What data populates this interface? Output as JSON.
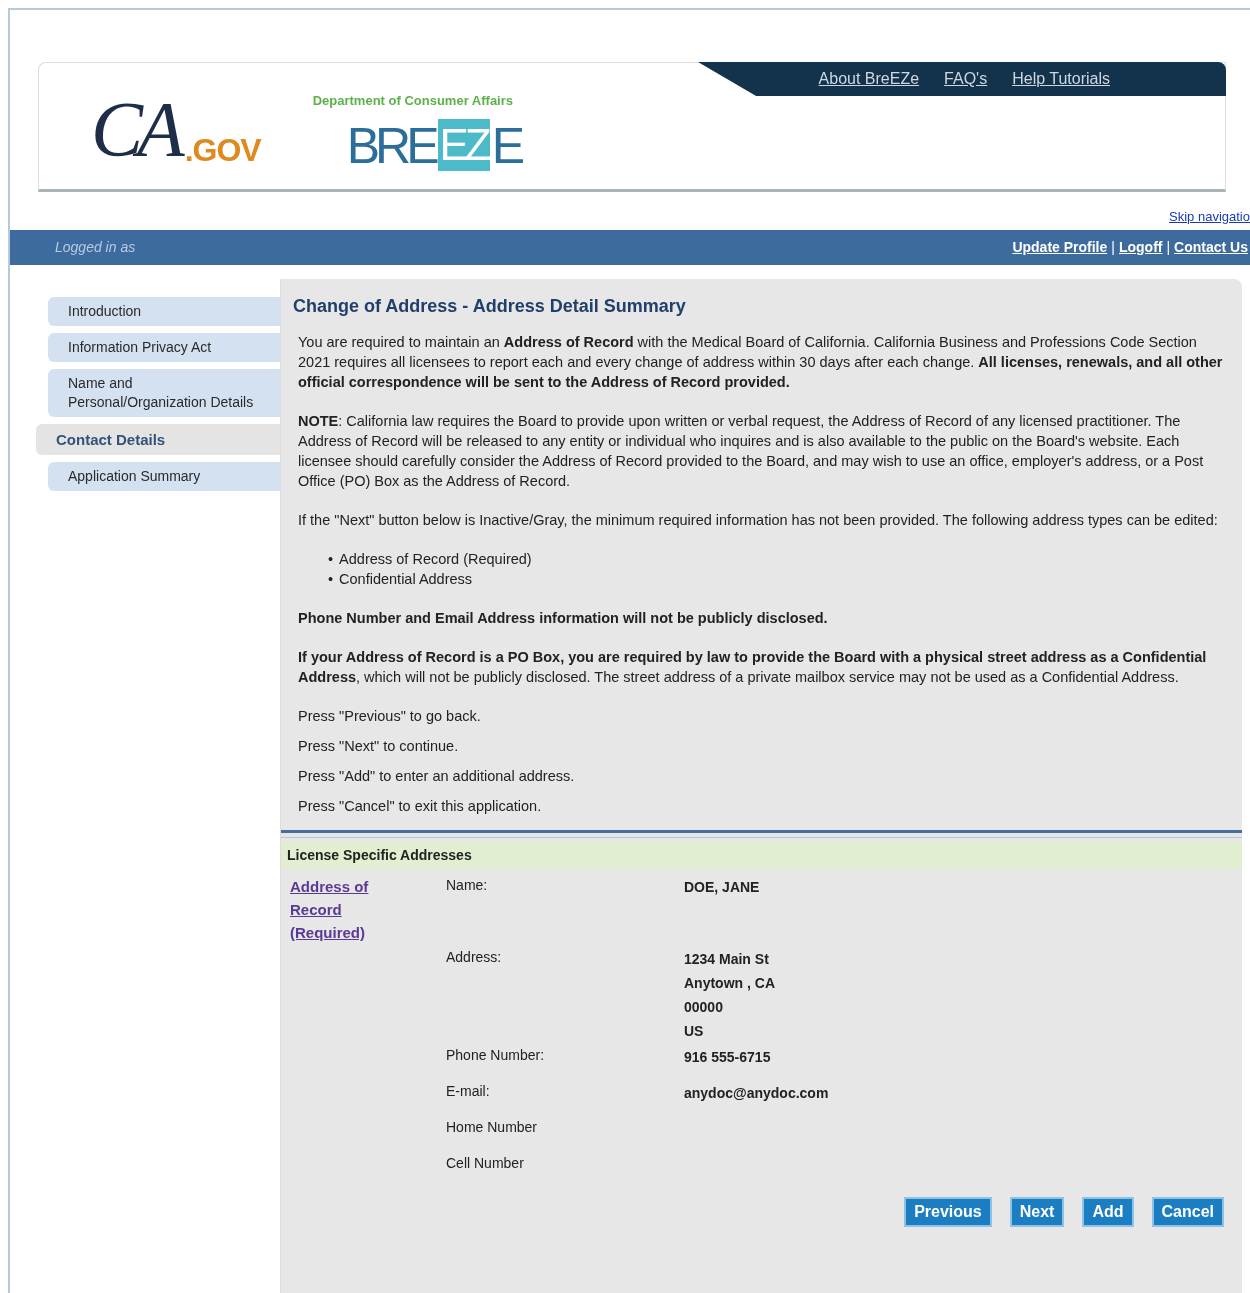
{
  "header": {
    "ca_logo": {
      "letters": "CA",
      "domain": ".GOV"
    },
    "department": "Department of Consumer Affairs",
    "breeze_logo": {
      "before": "BRE",
      "boxed": "EZ",
      "after": "E"
    },
    "top_links": [
      "About BreEZe",
      "FAQ's",
      "Help Tutorials"
    ]
  },
  "skip_link": "Skip navigatio",
  "user_bar": {
    "logged_in": "Logged in as",
    "links": [
      "Update Profile",
      "Logoff",
      "Contact Us"
    ],
    "separator": "|"
  },
  "sidebar": [
    {
      "label": "Introduction",
      "selected": false
    },
    {
      "label": "Information Privacy Act",
      "selected": false
    },
    {
      "label": "Name and Personal/Organization Details",
      "selected": false
    },
    {
      "label": "Contact Details",
      "selected": true
    },
    {
      "label": "Application Summary",
      "selected": false
    }
  ],
  "title": "Change of Address - Address Detail Summary",
  "content": [
    {
      "kind": "paragraph",
      "text": "You are required to maintain an **Address of Record** with the Medical Board of California. California Business and Professions Code Section 2021 requires all licensees to report each and every change of address within 30 days after each change. **All licenses, renewals, and all other official correspondence will be sent to the Address of Record provided.**"
    },
    {
      "kind": "paragraph",
      "text": "**NOTE**: California law requires the Board to provide upon written or verbal request, the Address of Record of any licensed practitioner. The Address of Record will be released to any entity or individual who inquires and is also available to the public on the Board's website. Each licensee should carefully consider the Address of Record provided to the Board, and may wish to use an office, employer's address, or a Post Office (PO) Box as the Address of Record."
    },
    {
      "kind": "paragraph",
      "text": "If the \"Next\" button below is Inactive/Gray, the minimum required information has not been provided. The following address types can be edited:"
    },
    {
      "kind": "bullets",
      "marker": "•",
      "items": [
        "Address of Record (Required)",
        "Confidential Address"
      ]
    },
    {
      "kind": "paragraph",
      "text": "**Phone Number and Email Address information will not be publicly disclosed.**"
    },
    {
      "kind": "paragraph",
      "text": "**If your Address of Record is a PO Box, you are required by law to provide the Board with a physical street address as a Confidential Address**, which will not be publicly disclosed. The street address of a private mailbox service may not be used as a Confidential Address."
    },
    {
      "kind": "instruction",
      "text": "Press \"Previous\" to go back."
    },
    {
      "kind": "instruction",
      "text": "Press \"Next\" to continue."
    },
    {
      "kind": "instruction",
      "text": "Press \"Add\" to enter an additional address."
    },
    {
      "kind": "instruction",
      "text": "Press \"Cancel\" to exit this application."
    }
  ],
  "section": {
    "title": "License Specific Addresses",
    "address_link": "Address of Record (Required)",
    "fields": [
      {
        "label": "Name:",
        "values": [
          "DOE, JANE"
        ]
      },
      {
        "label": "Address:",
        "values": [
          "1234 Main St",
          "Anytown , CA",
          "00000",
          "US"
        ]
      },
      {
        "label": "Phone Number:",
        "values": [
          "916 555-6715"
        ]
      },
      {
        "label": "E-mail:",
        "values": [
          "anydoc@anydoc.com"
        ]
      },
      {
        "label": "Home Number"
      },
      {
        "label": "Cell Number"
      }
    ]
  },
  "buttons": [
    "Previous",
    "Next",
    "Add",
    "Cancel"
  ]
}
